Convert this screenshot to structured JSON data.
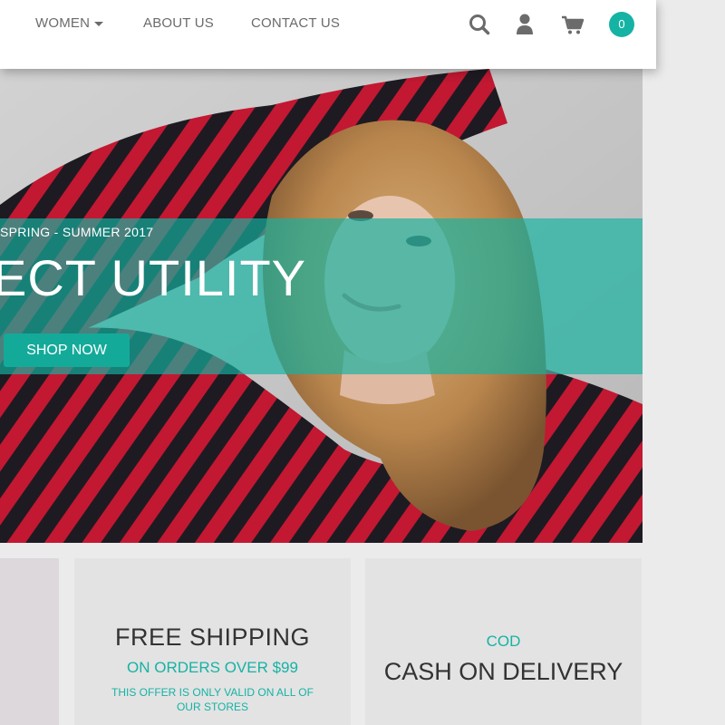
{
  "nav": {
    "items": [
      {
        "label": "WOMEN",
        "has_dropdown": true
      },
      {
        "label": "ABOUT US"
      },
      {
        "label": "CONTACT US"
      }
    ],
    "icons": [
      "search-icon",
      "user-icon",
      "cart-icon"
    ],
    "cart_count": "0"
  },
  "hero": {
    "season": "SPRING - SUMMER 2017",
    "title": "ECT UTILITY",
    "cta_label": "SHOP NOW"
  },
  "features": {
    "shipping": {
      "title": "FREE SHIPPING",
      "subtitle": "ON ORDERS OVER $99",
      "note": "THIS OFFER IS ONLY VALID ON ALL OF OUR STORES"
    },
    "cod": {
      "label": "COD",
      "title": "CASH ON DELIVERY"
    }
  },
  "colors": {
    "accent": "#15b3a4",
    "text_dark": "#333333",
    "nav_text": "#6b6b6b"
  }
}
